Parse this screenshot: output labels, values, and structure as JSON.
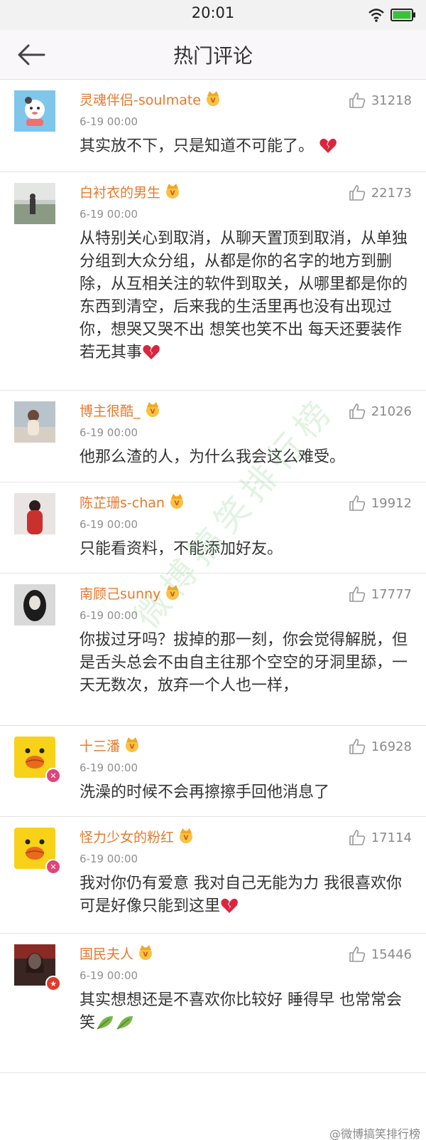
{
  "status_bar": {
    "time": "20:01"
  },
  "nav": {
    "title": "热门评论"
  },
  "comments": [
    {
      "user": "灵魂伴侣-soulmate",
      "time": "6-19 00:00",
      "likes": "31218",
      "text": "其实放不下，只是知道不可能了。"
    },
    {
      "user": "白衬衣的男生",
      "time": "6-19 00:00",
      "likes": "22173",
      "text": "从特别关心到取消，从聊天置顶到取消，从单独分组到大众分组，从都是你的名字的地方到删除，从互相关注的软件到取关，从哪里都是你的东西到清空，后来我的生活里再也没有出现过你，想哭又哭不出  想笑也笑不出   每天还要装作若无其事"
    },
    {
      "user": "博主很酷_",
      "time": "6-19 00:00",
      "likes": "21026",
      "text": "他那么渣的人，为什么我会这么难受。"
    },
    {
      "user": "陈芷珊s-chan",
      "time": "6-19 00:00",
      "likes": "19912",
      "text": "只能看资料，不能添加好友。"
    },
    {
      "user": "南顾己sunny",
      "time": "6-19 00:00",
      "likes": "17777",
      "text": "你拔过牙吗？拔掉的那一刻，你会觉得解脱，但是舌头总会不由自主往那个空空的牙洞里舔，一天无数次，放弃一个人也一样，"
    },
    {
      "user": "十三潘",
      "time": "6-19 00:00",
      "likes": "16928",
      "text": "洗澡的时候不会再擦擦手回他消息了"
    },
    {
      "user": "怪力少女的粉红",
      "time": "6-19 00:00",
      "likes": "17114",
      "text": "我对你仍有爱意 我对自己无能为力 我很喜欢你 可是好像只能到这里"
    },
    {
      "user": "国民夫人",
      "time": "6-19 00:00",
      "likes": "15446",
      "text": "其实想想还是不喜欢你比较好 睡得早 也常常会笑"
    }
  ],
  "watermark": "微博搞笑排行榜",
  "footer_watermark": "@微博搞笑排行榜",
  "colors": {
    "username": "#e8792d",
    "accent_red": "#d9263f",
    "divider": "#e3e3e3"
  },
  "icons": {
    "back": "back-arrow-icon",
    "like": "thumbs-up-icon",
    "vip": "vip-crown-icon",
    "heartbreak": "broken-heart-emoji",
    "leaf": "leaf-emoji"
  }
}
